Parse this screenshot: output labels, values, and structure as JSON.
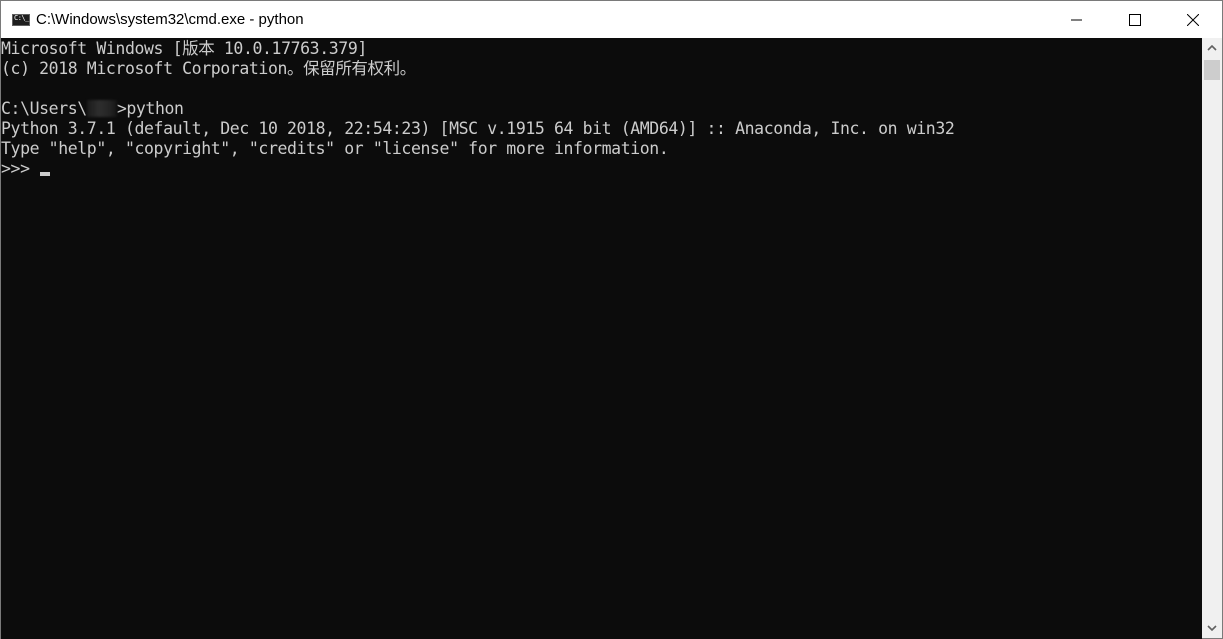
{
  "window": {
    "title": "C:\\Windows\\system32\\cmd.exe - python",
    "app_icon": "cmd-icon",
    "controls": {
      "minimize": "minimize-icon",
      "maximize": "maximize-icon",
      "close": "close-icon"
    }
  },
  "terminal": {
    "lines": [
      "Microsoft Windows [版本 10.0.17763.379]",
      "(c) 2018 Microsoft Corporation。保留所有权利。",
      "",
      "C:\\Users\\",
      "Python 3.7.1 (default, Dec 10 2018, 22:54:23) [MSC v.1915 64 bit (AMD64)] :: Anaconda, Inc. on win32",
      "Type \"help\", \"copyright\", \"credits\" or \"license\" for more information.",
      ">>>"
    ],
    "prompt_command": ">python",
    "username_redacted": true
  },
  "scrollbar": {
    "up": "chevron-up-icon",
    "down": "chevron-down-icon",
    "position": 0
  }
}
